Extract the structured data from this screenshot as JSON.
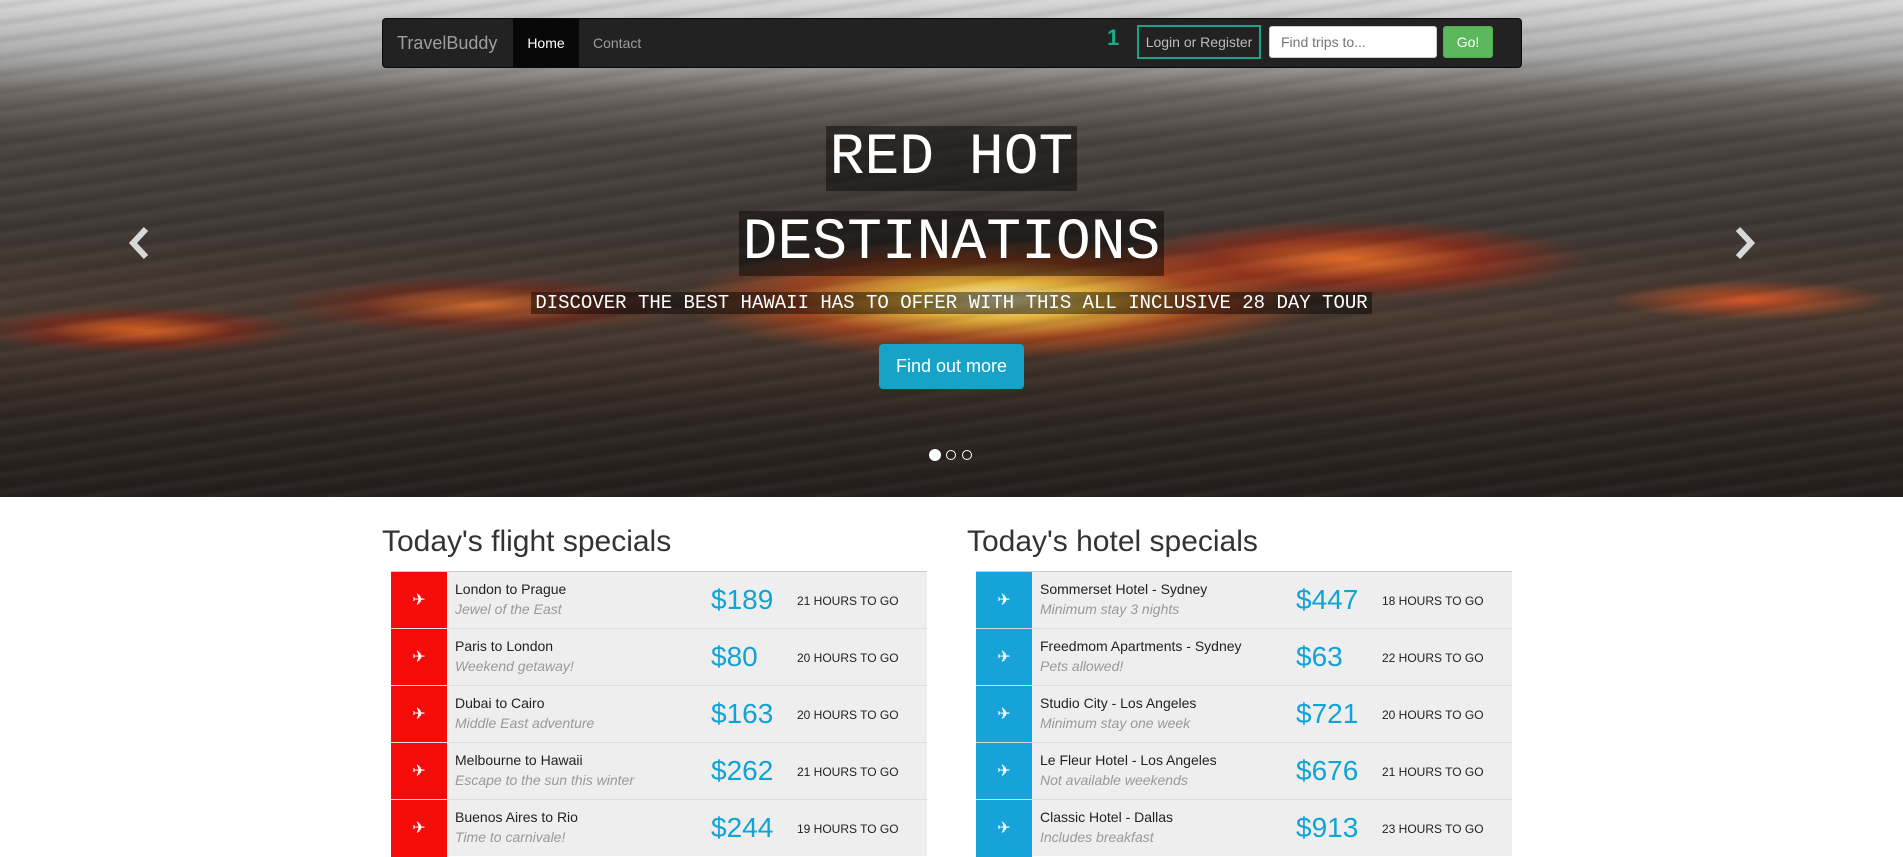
{
  "navbar": {
    "brand": "TravelBuddy",
    "home": "Home",
    "contact": "Contact",
    "badge_count": "1",
    "login": "Login or Register",
    "search_placeholder": "Find trips to...",
    "go": "Go!"
  },
  "hero": {
    "line1": "RED HOT",
    "line2": "DESTINATIONS",
    "subtitle": "DISCOVER THE BEST HAWAII HAS TO OFFER WITH THIS ALL INCLUSIVE 28 DAY TOUR",
    "button": "Find out more",
    "prev_icon": "chevron-left-icon",
    "next_icon": "chevron-right-icon",
    "indicator_count": 3,
    "active_indicator": 0
  },
  "flights": {
    "title": "Today's flight specials",
    "icon": "paper-plane-icon",
    "accent": "#f60b0b",
    "items": [
      {
        "route": "London to Prague",
        "tagline": "Jewel of the East",
        "price": "$189",
        "time": "21 HOURS TO GO"
      },
      {
        "route": "Paris to London",
        "tagline": "Weekend getaway!",
        "price": "$80",
        "time": "20 HOURS TO GO"
      },
      {
        "route": "Dubai to Cairo",
        "tagline": "Middle East adventure",
        "price": "$163",
        "time": "20 HOURS TO GO"
      },
      {
        "route": "Melbourne to Hawaii",
        "tagline": "Escape to the sun this winter",
        "price": "$262",
        "time": "21 HOURS TO GO"
      },
      {
        "route": "Buenos Aires to Rio",
        "tagline": "Time to carnivale!",
        "price": "$244",
        "time": "19 HOURS TO GO"
      }
    ]
  },
  "hotels": {
    "title": "Today's hotel specials",
    "icon": "paper-plane-icon",
    "accent": "#17a3d9",
    "items": [
      {
        "name": "Sommerset Hotel - Sydney",
        "tagline": "Minimum stay 3 nights",
        "price": "$447",
        "time": "18 HOURS TO GO"
      },
      {
        "name": "Freedmom Apartments - Sydney",
        "tagline": "Pets allowed!",
        "price": "$63",
        "time": "22 HOURS TO GO"
      },
      {
        "name": "Studio City - Los Angeles",
        "tagline": "Minimum stay one week",
        "price": "$721",
        "time": "20 HOURS TO GO"
      },
      {
        "name": "Le Fleur Hotel - Los Angeles",
        "tagline": "Not available weekends",
        "price": "$676",
        "time": "21 HOURS TO GO"
      },
      {
        "name": "Classic Hotel - Dallas",
        "tagline": "Includes breakfast",
        "price": "$913",
        "time": "23 HOURS TO GO"
      }
    ]
  },
  "colors": {
    "nav_bg": "#222222",
    "login_border": "#17a58a",
    "go_green": "#5cb85c",
    "find_button": "#17a3c7",
    "price_blue": "#0fa3d6"
  }
}
